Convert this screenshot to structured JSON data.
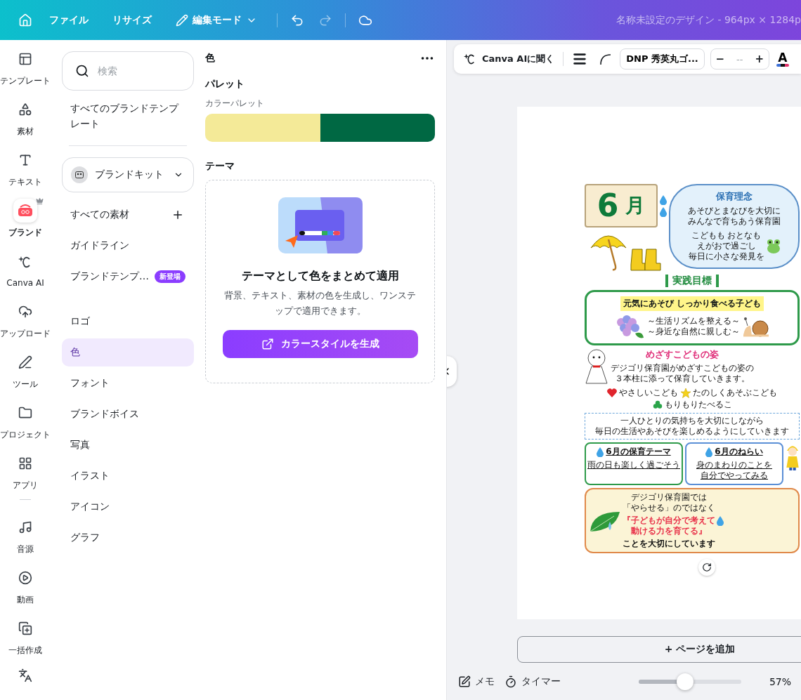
{
  "topbar": {
    "menus": [
      "ファイル",
      "リサイズ"
    ],
    "mode": "編集モード",
    "title": "名称未設定のデザイン - 964px × 1284p"
  },
  "rail": [
    {
      "label": "テンプレート",
      "selected": false,
      "premium": false
    },
    {
      "label": "素材",
      "selected": false,
      "premium": false
    },
    {
      "label": "テキスト",
      "selected": false,
      "premium": false
    },
    {
      "label": "ブランド",
      "selected": true,
      "premium": true
    },
    {
      "label": "Canva AI",
      "selected": false,
      "premium": false
    },
    {
      "label": "アップロード",
      "selected": false,
      "premium": false
    },
    {
      "label": "ツール",
      "selected": false,
      "premium": false
    },
    {
      "label": "プロジェクト",
      "selected": false,
      "premium": false
    },
    {
      "label": "アプリ",
      "selected": false,
      "premium": false
    },
    {
      "label": "音源",
      "selected": false,
      "premium": false
    },
    {
      "label": "動画",
      "selected": false,
      "premium": false
    },
    {
      "label": "一括作成",
      "selected": false,
      "premium": false
    }
  ],
  "brand_panel": {
    "search": {
      "placeholder": "検索"
    },
    "all_templates": "すべてのブランドテンプレート",
    "kit": "ブランドキット",
    "sections": [
      [
        {
          "label": "すべての素材",
          "kind": "add",
          "selected": false
        },
        {
          "label": "ガイドライン",
          "kind": "plain",
          "selected": false
        },
        {
          "label": "ブランドテンプ…",
          "kind": "badge",
          "badge": "新登場",
          "selected": false
        }
      ],
      [
        {
          "label": "ロゴ",
          "kind": "plain",
          "selected": false
        },
        {
          "label": "色",
          "kind": "plain",
          "selected": true
        },
        {
          "label": "フォント",
          "kind": "plain",
          "selected": false
        },
        {
          "label": "ブランドボイス",
          "kind": "plain",
          "selected": false
        },
        {
          "label": "写真",
          "kind": "plain",
          "selected": false
        },
        {
          "label": "イラスト",
          "kind": "plain",
          "selected": false
        },
        {
          "label": "アイコン",
          "kind": "plain",
          "selected": false
        },
        {
          "label": "グラフ",
          "kind": "plain",
          "selected": false
        }
      ]
    ]
  },
  "color_panel": {
    "title": "色",
    "palette_heading": "パレット",
    "palette_label": "カラーパレット",
    "swatches": [
      {
        "color": "#f4ea98"
      },
      {
        "color": "#006843"
      }
    ],
    "theme_heading": "テーマ",
    "theme_card": {
      "title": "テーマとして色をまとめて適用",
      "description": "背景、テキスト、素材の色を生成し、ワンステップで適用できます。",
      "button": "カラースタイルを生成"
    }
  },
  "toolbar": {
    "ai": "Canva AIに聞く",
    "font": "DNP 秀英丸ゴ...",
    "minus": "−",
    "size": "--",
    "plus": "+",
    "color_letter": "A"
  },
  "design": {
    "month_number": "6",
    "month_unit": "月",
    "philosophy": {
      "title": "保育理念",
      "lines": [
        "あそびとまなびを大切に",
        "みんなで育ちあう保育園"
      ],
      "motto": [
        "こどもも おとなも",
        "えがおで過ごし",
        "毎日に小さな発見を"
      ]
    },
    "goal": {
      "title": "実践目標",
      "headline": "元気にあそび しっかり食べる子ども",
      "sub": [
        "～生活リズムを整える～",
        "～身近な自然に親しむ～"
      ]
    },
    "vision": {
      "title": "めざすこどもの姿",
      "intro": [
        "デジゴリ保育園がめざすこどもの姿の",
        "３本柱に添って保育していきます。"
      ],
      "pillars": [
        "やさしいこども",
        "たのしくあそぶこども",
        "もりもりたべるこ"
      ],
      "note": [
        "一人ひとりの気持ちを大切にしながら",
        "毎日の生活やあそびを楽しめるようにしていきます"
      ]
    },
    "themes": [
      {
        "title": "6月の保育テーマ",
        "text": [
          "雨の日も楽しく過ごそう"
        ]
      },
      {
        "title": "6月のねらい",
        "text": [
          "身のまわりのことを",
          "自分でやってみる"
        ]
      }
    ],
    "closing": {
      "lead": [
        "デジゴリ保育園では",
        "「やらせる」のではなく"
      ],
      "emphasis": [
        "『子どもが自分で考えて",
        "動ける力を育てる』"
      ],
      "end": "ことを大切にしています"
    }
  },
  "footer": {
    "add_page": "+ ページを追加",
    "memo": "メモ",
    "timer": "タイマー",
    "zoom": {
      "level": 0.45,
      "reading": "57%"
    }
  }
}
